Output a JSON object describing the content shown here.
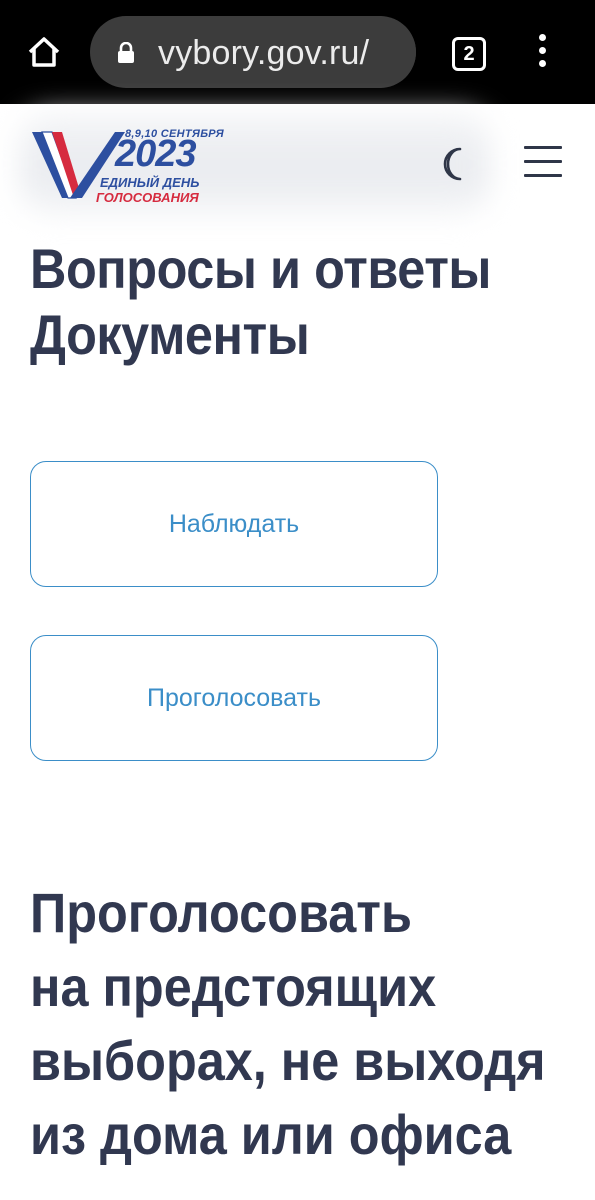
{
  "browser": {
    "url": "vybory.gov.ru/",
    "tab_count": "2",
    "icons": [
      "home-icon",
      "lock-icon",
      "tabs-icon",
      "overflow-menu-icon"
    ]
  },
  "header": {
    "logo": {
      "dates": "8,9,10 СЕНТЯБРЯ",
      "year": "2023",
      "line1": "ЕДИНЫЙ ДЕНЬ",
      "line2": "ГОЛОСОВАНИЯ"
    },
    "icons": [
      "moon-icon",
      "hamburger-icon"
    ]
  },
  "nav": {
    "links": [
      "Вопросы и ответы",
      "Документы"
    ]
  },
  "actions": {
    "observe": "Наблюдать",
    "vote": "Проголосовать"
  },
  "promo": {
    "lines": [
      "Проголосовать",
      "на предстоящих",
      "выборах, не выходя",
      "из дома или офиса"
    ]
  },
  "colors": {
    "heading": "#313850",
    "accent": "#3b8ec8",
    "logo_blue": "#2d4fa0",
    "logo_red": "#d62b3f"
  }
}
